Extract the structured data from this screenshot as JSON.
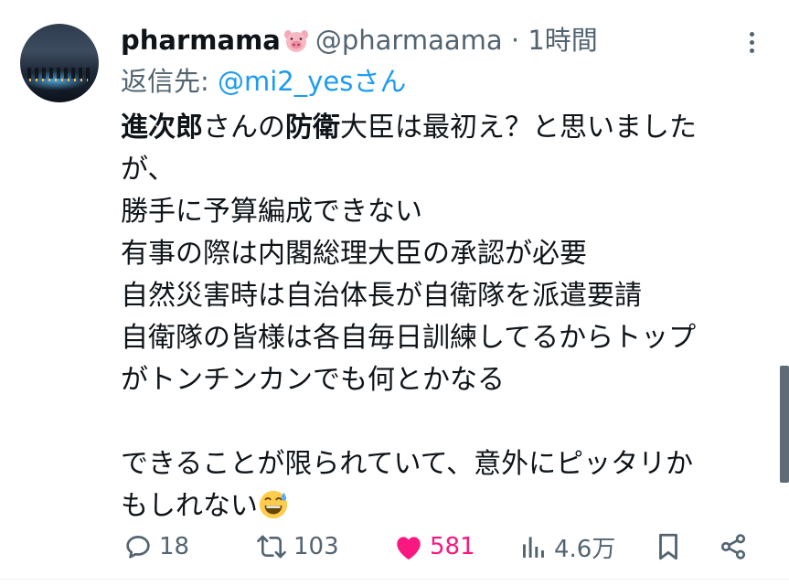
{
  "post": {
    "author_name": "pharmama",
    "author_emoji": "pig-face",
    "handle": "@pharmaama",
    "separator": "·",
    "time": "1時間",
    "reply_prefix": "返信先: ",
    "reply_to": "@mi2_yesさん",
    "body_lines": [
      [
        {
          "t": "進次郎",
          "b": true
        },
        {
          "t": "さんの",
          "b": false
        },
        {
          "t": "防衛",
          "b": true
        },
        {
          "t": "大臣は最初え？と思いました",
          "b": false
        }
      ],
      [
        {
          "t": "が、",
          "b": false
        }
      ],
      [
        {
          "t": "勝手に予算編成できない",
          "b": false
        }
      ],
      [
        {
          "t": "有事の際は内閣総理大臣の承認が必要",
          "b": false
        }
      ],
      [
        {
          "t": "自然災害時は自治体長が自衛隊を派遣要請",
          "b": false
        }
      ],
      [
        {
          "t": "自衛隊の皆様は各自毎日訓練してるからトップ",
          "b": false
        }
      ],
      [
        {
          "t": "がトンチンカンでも何とかなる",
          "b": false
        }
      ],
      [],
      [
        {
          "t": "できることが限られていて、意外にピッタリか",
          "b": false
        }
      ],
      [
        {
          "t": "もしれない",
          "b": false
        }
      ]
    ],
    "end_emoji": "grinning-face-with-sweat"
  },
  "actions": {
    "replies": "18",
    "reposts": "103",
    "likes": "581",
    "views": "4.6万"
  },
  "colors": {
    "text": "#0f1419",
    "secondary": "#536471",
    "link": "#1d9bf0",
    "like": "#f91880"
  }
}
